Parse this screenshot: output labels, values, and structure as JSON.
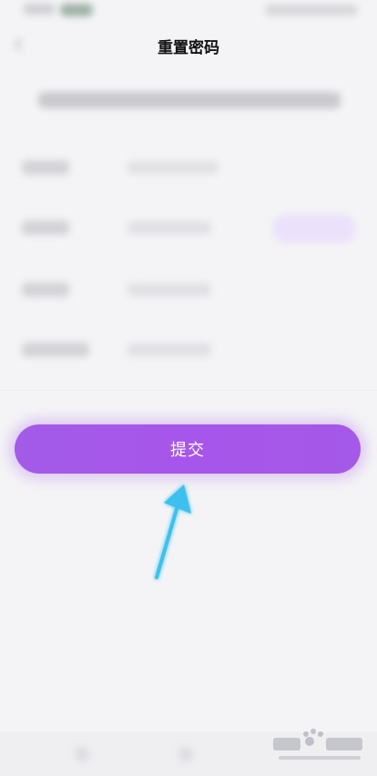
{
  "header": {
    "title": "重置密码",
    "back_icon": "chevron-left-icon"
  },
  "form": {
    "submit_label": "提交"
  },
  "colors": {
    "accent": "#a656ea",
    "arrow": "#3cc0ee"
  },
  "overlay": {
    "arrow_icon": "arrow-up-right-icon"
  }
}
